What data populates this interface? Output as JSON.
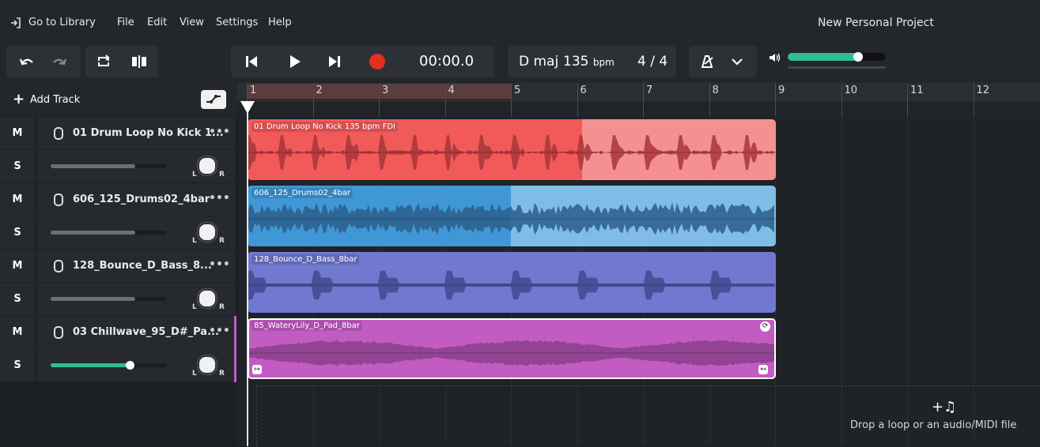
{
  "menu": {
    "go_to_library": "Go to Library",
    "file": "File",
    "edit": "Edit",
    "view": "View",
    "settings": "Settings",
    "help": "Help",
    "project_title": "New Personal Project"
  },
  "transport": {
    "time": "00:00.0",
    "key": "D maj",
    "tempo_value": "135",
    "tempo_unit": "bpm",
    "time_signature": "4 / 4",
    "master_volume": 0.72
  },
  "tracks_panel": {
    "add_track": "Add Track"
  },
  "ruler": [
    "1",
    "2",
    "3",
    "4",
    "5",
    "6",
    "7",
    "8",
    "9",
    "10",
    "11",
    "12"
  ],
  "tracks": [
    {
      "name": "01 Drum Loop No Kick 1...",
      "mute": "M",
      "solo": "S",
      "volume": 0.73,
      "knob_l": "L",
      "knob_r": "R",
      "clip_label": "01 Drum Loop No Kick 135 bpm FDI",
      "color": "#f25a5a",
      "color_light": "#f59090"
    },
    {
      "name": "606_125_Drums02_4bar",
      "mute": "M",
      "solo": "S",
      "volume": 0.73,
      "knob_l": "L",
      "knob_r": "R",
      "clip_label": "606_125_Drums02_4bar",
      "color": "#3f97d6",
      "color_light": "#7fbde6"
    },
    {
      "name": "128_Bounce_D_Bass_8...",
      "mute": "M",
      "solo": "S",
      "volume": 0.73,
      "knob_l": "L",
      "knob_r": "R",
      "clip_label": "128_Bounce_D_Bass_8bar",
      "color": "#7078cf",
      "color_light": "#7078cf"
    },
    {
      "name": "03 Chillwave_95_D#_Pa...",
      "mute": "M",
      "solo": "S",
      "volume": 0.69,
      "knob_l": "L",
      "knob_r": "R",
      "clip_label": "85_WateryLily_D_Pad_8bar",
      "color": "#c25cc2",
      "color_light": "#c25cc2"
    }
  ],
  "dropzone": {
    "hint": "Drop a loop or an audio/MIDI file"
  },
  "colors": {
    "accent": "#2fbf8f",
    "playhead": "#ffffff",
    "record": "#e0301e"
  }
}
